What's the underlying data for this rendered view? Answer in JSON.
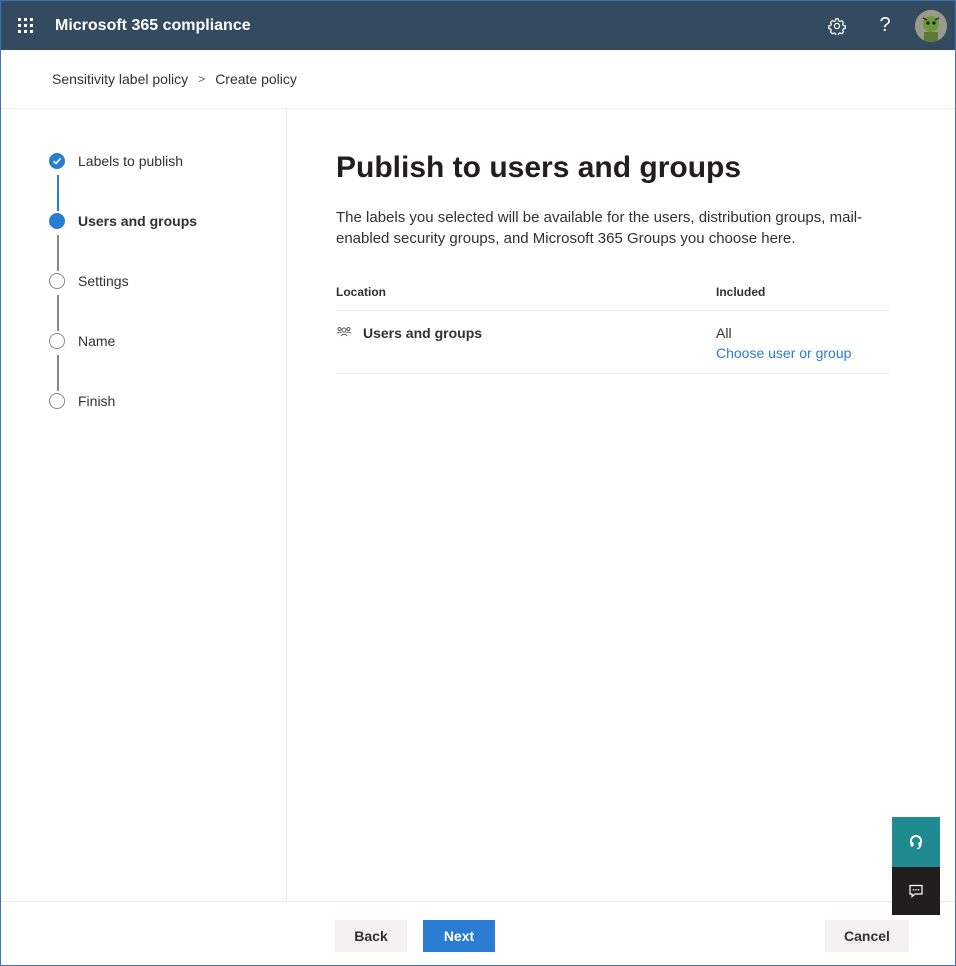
{
  "header": {
    "app_title": "Microsoft 365 compliance",
    "waffle_icon": "waffle-icon",
    "settings_icon": "gear-icon",
    "help_label": "?",
    "avatar_icon": "avatar"
  },
  "breadcrumb": {
    "items": [
      "Sensitivity label policy",
      "Create policy"
    ],
    "separator": ">"
  },
  "steps": [
    {
      "label": "Labels to publish",
      "state": "done"
    },
    {
      "label": "Users and groups",
      "state": "current"
    },
    {
      "label": "Settings",
      "state": "pending"
    },
    {
      "label": "Name",
      "state": "pending"
    },
    {
      "label": "Finish",
      "state": "pending"
    }
  ],
  "main": {
    "title": "Publish to users and groups",
    "description": "The labels you selected will be available for the users, distribution groups, mail-enabled security groups, and Microsoft 365 Groups you choose here.",
    "table": {
      "columns": [
        "Location",
        "Included"
      ],
      "rows": [
        {
          "location": "Users and groups",
          "icon": "users-group-icon",
          "included": "All",
          "action": "Choose user or group"
        }
      ]
    }
  },
  "footer": {
    "back_label": "Back",
    "next_label": "Next",
    "cancel_label": "Cancel"
  },
  "colors": {
    "header_bg": "#344a5f",
    "accent": "#2b7cd3",
    "help_bg": "#1f8a8f",
    "feedback_bg": "#201f1e"
  }
}
